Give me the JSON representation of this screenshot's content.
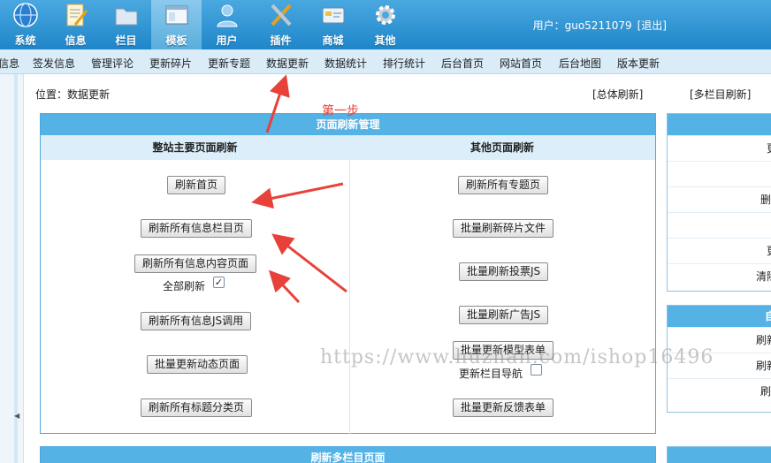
{
  "topnav": {
    "items": [
      {
        "label": "系统",
        "icon": "globe-icon"
      },
      {
        "label": "信息",
        "icon": "document-pencil-icon"
      },
      {
        "label": "栏目",
        "icon": "folder-icon"
      },
      {
        "label": "模板",
        "icon": "window-template-icon"
      },
      {
        "label": "用户",
        "icon": "user-icon"
      },
      {
        "label": "插件",
        "icon": "tools-icon"
      },
      {
        "label": "商城",
        "icon": "card-icon"
      },
      {
        "label": "其他",
        "icon": "gear-icon"
      }
    ],
    "active": "模板",
    "user_text": "用户：guo5211079",
    "logout": "[退出]"
  },
  "subnav": [
    "信息",
    "签发信息",
    "管理评论",
    "更新碎片",
    "更新专题",
    "数据更新",
    "数据统计",
    "排行统计",
    "后台首页",
    "网站首页",
    "后台地图",
    "版本更新"
  ],
  "breadcrumb": "位置：数据更新",
  "top_links": {
    "total_refresh": "[总体刷新]",
    "multi_col": "[多栏目刷新]"
  },
  "panel": {
    "title": "页面刷新管理",
    "left_header": "整站主要页面刷新",
    "right_header": "其他页面刷新",
    "left_buttons": [
      "刷新首页",
      "刷新所有信息栏目页",
      "刷新所有信息内容页面",
      "刷新所有信息JS调用",
      "批量更新动态页面",
      "刷新所有标题分类页"
    ],
    "all_refresh_label": "全部刷新",
    "all_refresh_checked": true,
    "right_buttons": [
      "刷新所有专题页",
      "批量刷新碎片文件",
      "批量刷新投票JS",
      "批量刷新广告JS",
      "批量更新模型表单",
      "批量更新反馈表单"
    ],
    "col_nav_label": "更新栏目导航",
    "col_nav_checked": false
  },
  "annotation": "第一步",
  "watermark": "https://www.huzhan.com/ishop16496",
  "right_panel_1": {
    "rows": [
      "更",
      "",
      "删",
      "",
      "更",
      "清除"
    ]
  },
  "right_panel_2": {
    "title": "自",
    "rows": [
      "刷新",
      "刷新",
      "刷"
    ]
  },
  "bottom_panel": {
    "title": "刷新多栏目页面"
  },
  "colors": {
    "accent": "#55b2e5",
    "topbar": "#1f86c9",
    "arrow": "#e8413a"
  }
}
